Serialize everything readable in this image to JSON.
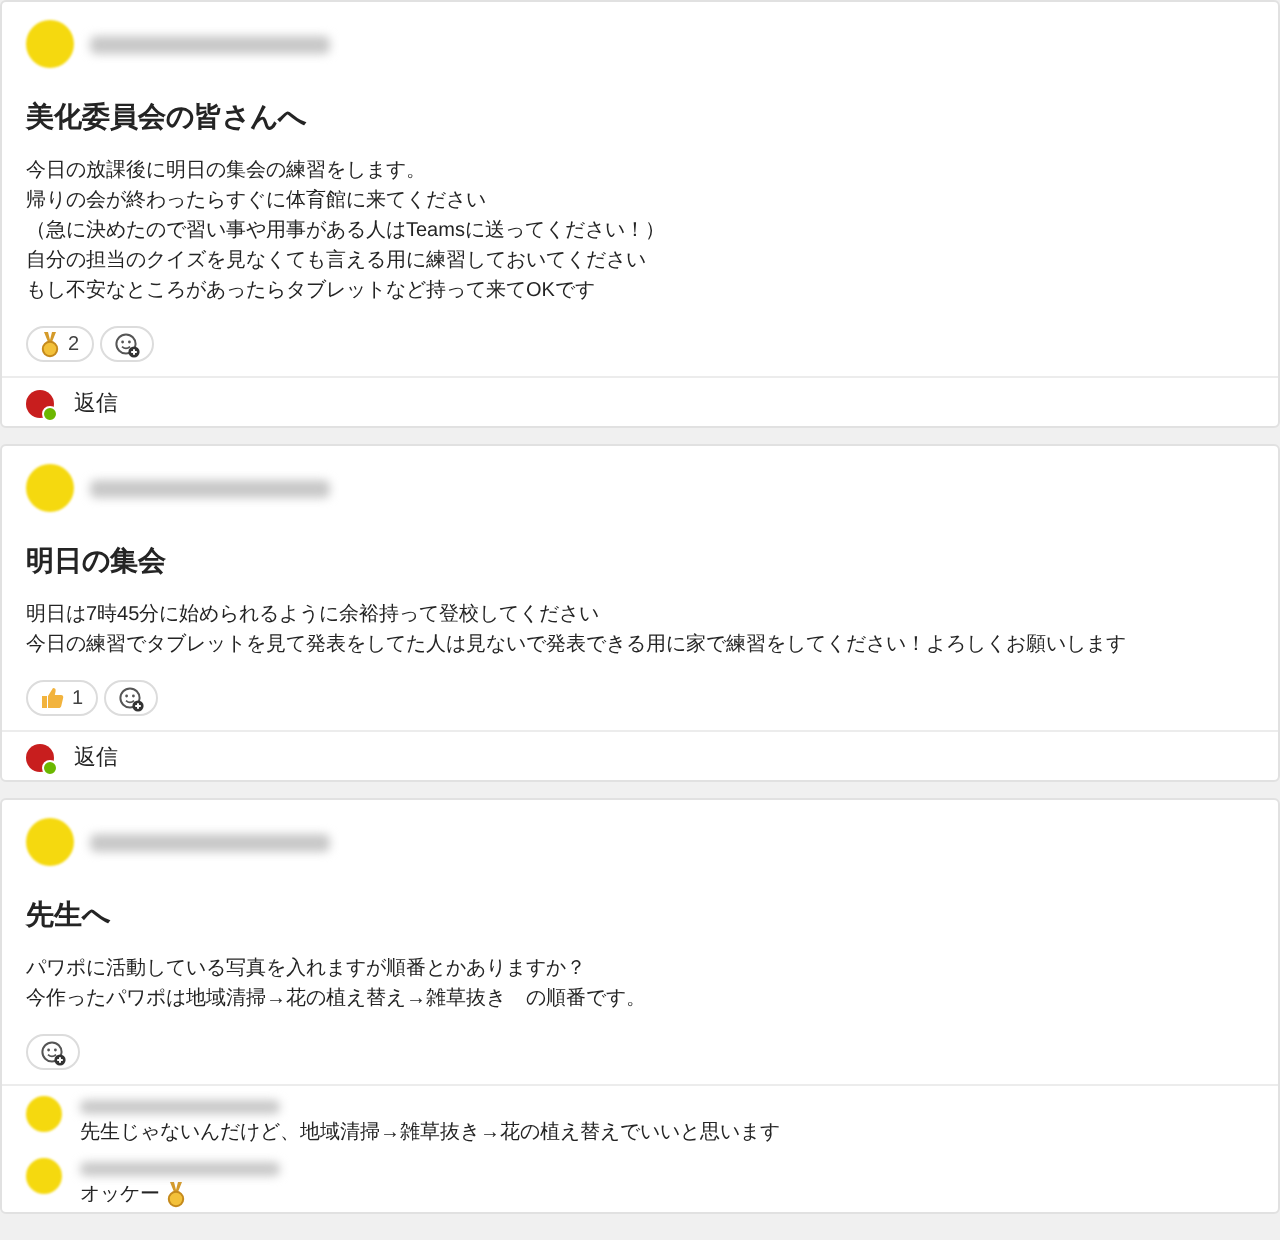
{
  "posts": [
    {
      "title": "美化委員会の皆さんへ",
      "body": [
        "今日の放課後に明日の集会の練習をします。",
        "帰りの会が終わったらすぐに体育館に来てください",
        "（急に決めたので習い事や用事がある人はTeamsに送ってください！）",
        "自分の担当のクイズを見なくても言える用に練習しておいてください",
        "もし不安なところがあったらタブレットなど持って来てOKです"
      ],
      "reactions": [
        {
          "kind": "medal",
          "count": "2"
        }
      ],
      "reply_label": "返信"
    },
    {
      "title": "明日の集会",
      "body": [
        "明日は7時45分に始められるように余裕持って登校してください",
        "今日の練習でタブレットを見て発表をしてた人は見ないで発表できる用に家で練習をしてください！よろしくお願いします"
      ],
      "reactions": [
        {
          "kind": "thumbs",
          "count": "1"
        }
      ],
      "reply_label": "返信"
    },
    {
      "title": "先生へ",
      "body": [
        "パワポに活動している写真を入れますが順番とかありますか？",
        "今作ったパワポは地域清掃→花の植え替え→雑草抜き　の順番です。"
      ],
      "replies": [
        {
          "kind": "plain",
          "text": "先生じゃないんだけど、地域清掃→雑草抜き→花の植え替えでいいと思います"
        },
        {
          "kind": "medal",
          "text": "オッケー"
        }
      ]
    }
  ]
}
